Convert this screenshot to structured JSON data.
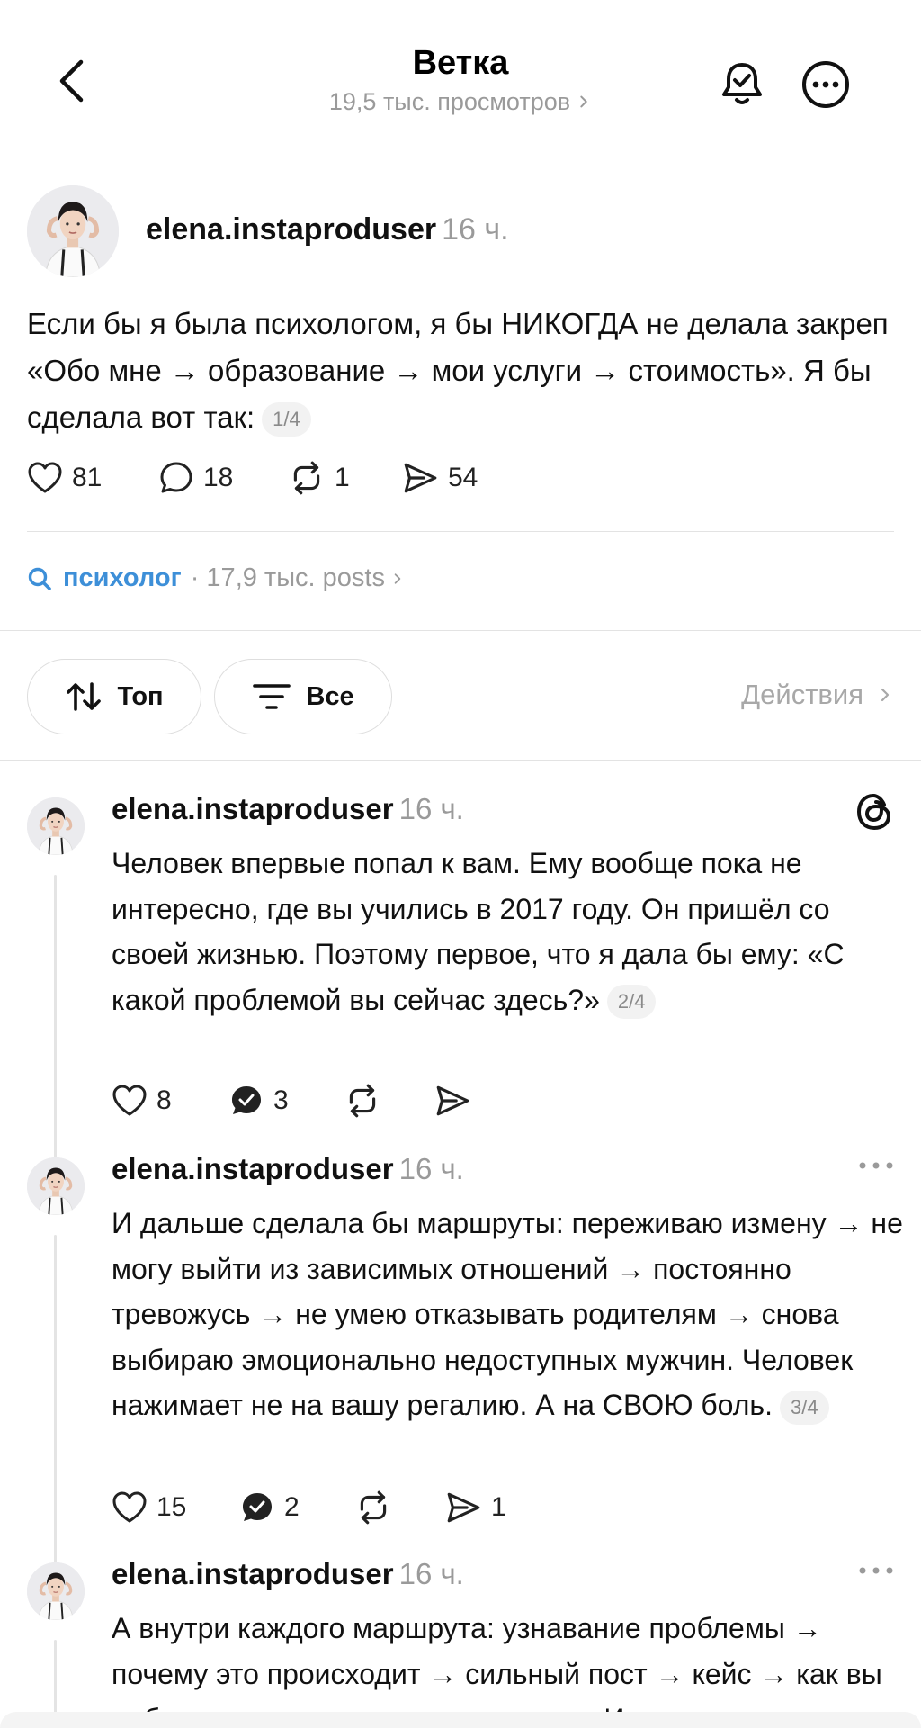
{
  "header": {
    "title": "Ветка",
    "views": "19,5 тыс. просмотров",
    "icons": [
      "chevron-left-icon",
      "bell-check-icon",
      "more-circle-icon"
    ]
  },
  "main_post": {
    "username": "elena.instaproduser",
    "time": "16 ч.",
    "text": "Если бы я была психологом, я бы НИКОГДА не делала закреп «Обо мне → образование → мои услуги → стоимость». Я бы сделала вот так:",
    "counter": "1/4",
    "likes": "81",
    "comments": "18",
    "reposts": "1",
    "shares": "54"
  },
  "topic": {
    "name": "психолог",
    "meta": "· 17,9 тыс. posts"
  },
  "filters": {
    "sort_label": "Топ",
    "filter_label": "Все",
    "actions_label": "Действия"
  },
  "replies": [
    {
      "username": "elena.instaproduser",
      "time": "16 ч.",
      "text": "Человек впервые попал к вам. Ему вообще пока не интересно, где вы учились в 2017 году. Он пришёл со своей жизнью. Поэтому первое, что я дала бы ему: «С какой проблемой вы сейчас здесь?»",
      "counter": "2/4",
      "likes": "8",
      "comments": "3",
      "reposts": "",
      "shares": ""
    },
    {
      "username": "elena.instaproduser",
      "time": "16 ч.",
      "text": "И дальше сделала бы маршруты: переживаю измену → не могу выйти из зависимых отношений → постоянно тревожусь → не умею отказывать родителям → снова выбираю эмоционально недоступных мужчин. Человек нажимает не на вашу регалию. А на СВОЮ боль.",
      "counter": "3/4",
      "likes": "15",
      "comments": "2",
      "reposts": "",
      "shares": "1"
    },
    {
      "username": "elena.instaproduser",
      "time": "16 ч.",
      "text": "А внутри каждого маршрута: узнавание проблемы → почему это происходит → сильный пост → кейс → как вы работаете → предложение помощи. И"
    }
  ],
  "colors": {
    "accent": "#3d8fd8",
    "muted": "#9a9a9a",
    "text": "#111111",
    "divider": "#e3e3e3"
  }
}
